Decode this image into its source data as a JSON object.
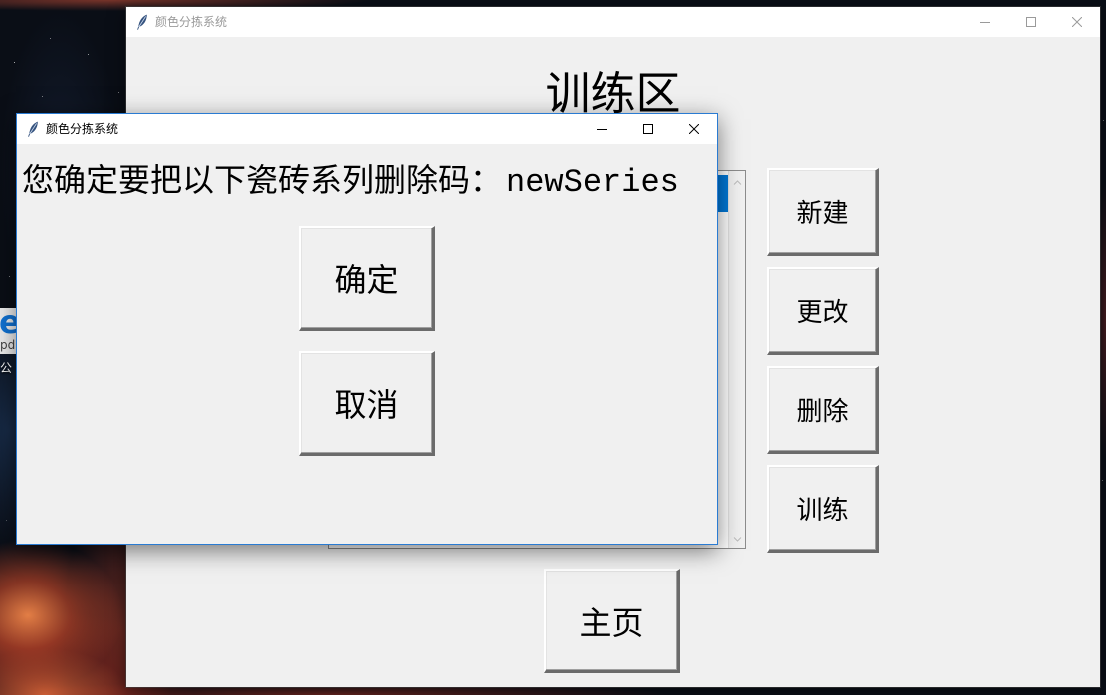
{
  "desktop": {
    "icon": {
      "logo_glyph": "e",
      "badge_text": "pd",
      "label": "公"
    }
  },
  "main_window": {
    "title": "颜色分拣系统",
    "heading": "训练区",
    "buttons": {
      "new": "新建",
      "edit": "更改",
      "delete": "删除",
      "train": "训练"
    },
    "home_button": "主页"
  },
  "dialog": {
    "title": "颜色分拣系统",
    "prompt": "您确定要把以下瓷砖系列删除码：",
    "series_name": "newSeries",
    "confirm_button": "确定",
    "cancel_button": "取消"
  },
  "icons": {
    "app": "feather-icon",
    "minimize": "minimize-icon",
    "maximize": "maximize-icon",
    "close": "close-icon",
    "scroll_up": "chevron-up-icon",
    "scroll_down": "chevron-down-icon",
    "desktop_file": "edge-pdf-icon"
  },
  "colors": {
    "window_bg": "#f0f0f0",
    "titlebar_bg": "#ffffff",
    "selection": "#0078d7",
    "dialog_border": "#2a7bd2",
    "inactive_caption": "#9a9a9a",
    "icon_blue": "#1173d4"
  }
}
